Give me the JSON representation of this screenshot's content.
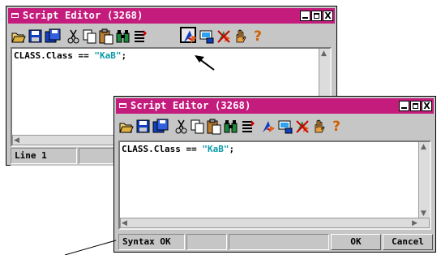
{
  "window_back": {
    "title": "Script Editor (3268)",
    "code": {
      "prefix": "CLASS.Class == ",
      "string": "\"KaB\"",
      "suffix": ";"
    },
    "status": {
      "line": "Line 1"
    }
  },
  "window_front": {
    "title": "Script Editor (3268)",
    "code": {
      "prefix": "CLASS.Class == ",
      "string": "\"KaB\"",
      "suffix": ";"
    },
    "status": {
      "message": "Syntax OK"
    },
    "buttons": {
      "ok": "OK",
      "cancel": "Cancel"
    }
  },
  "title_buttons": {
    "close_glyph": "X"
  },
  "toolbar": {
    "tools": [
      "open-icon",
      "save-icon",
      "save-as-icon",
      "cut-icon",
      "copy-icon",
      "paste-icon",
      "find-icon",
      "insert-icon",
      "check-syntax-icon",
      "preview-icon",
      "clear-icon",
      "hand-icon",
      "help-icon"
    ],
    "help_glyph": "?"
  },
  "colors": {
    "titlebar": "#c41c7c",
    "window_bg": "#c6c6c6",
    "string_literal": "#0a9aa8"
  }
}
